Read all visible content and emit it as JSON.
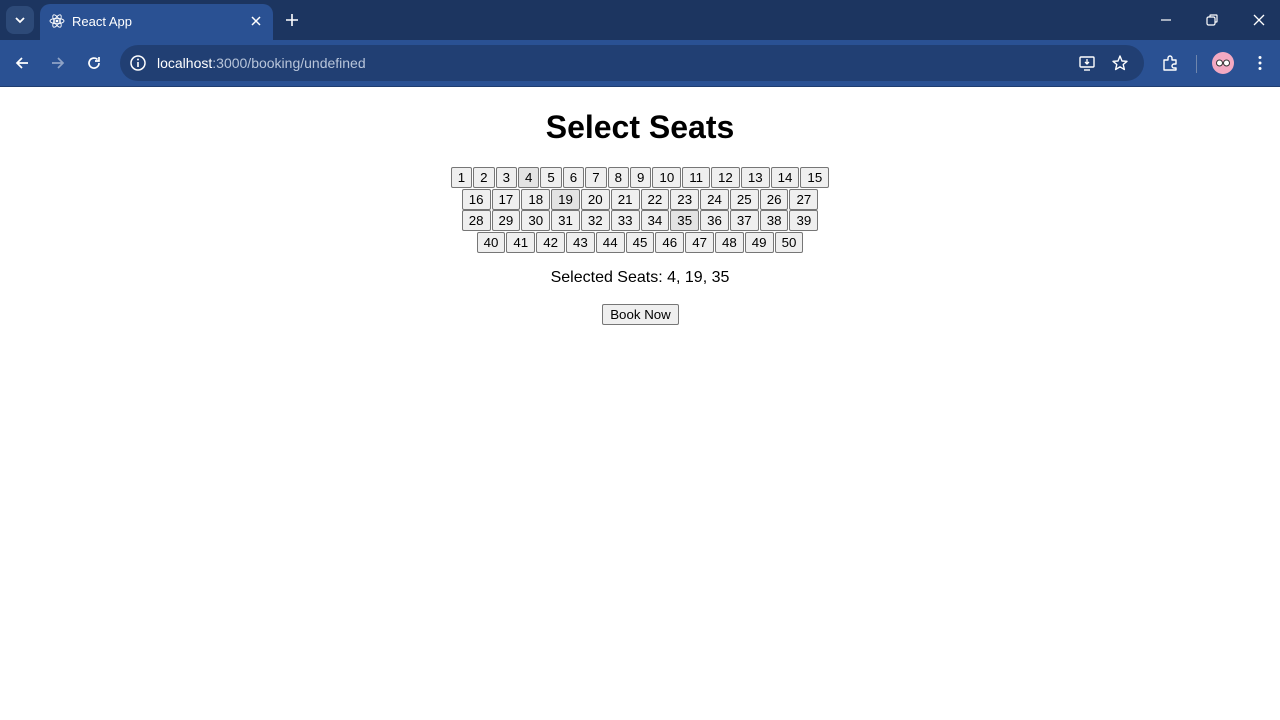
{
  "browser": {
    "tab_title": "React App",
    "url_host": "localhost",
    "url_rest": ":3000/booking/undefined"
  },
  "page": {
    "title": "Select Seats",
    "seat_rows": [
      [
        "1",
        "2",
        "3",
        "4",
        "5",
        "6",
        "7",
        "8",
        "9",
        "10",
        "11",
        "12",
        "13",
        "14",
        "15"
      ],
      [
        "16",
        "17",
        "18",
        "19",
        "20",
        "21",
        "22",
        "23",
        "24",
        "25",
        "26",
        "27"
      ],
      [
        "28",
        "29",
        "30",
        "31",
        "32",
        "33",
        "34",
        "35",
        "36",
        "37",
        "38",
        "39"
      ],
      [
        "40",
        "41",
        "42",
        "43",
        "44",
        "45",
        "46",
        "47",
        "48",
        "49",
        "50"
      ]
    ],
    "selected_seats_text": "Selected Seats: 4, 19, 35",
    "selected_seats": [
      "4",
      "19",
      "35"
    ],
    "book_button": "Book Now"
  },
  "colors": {
    "tabstrip": "#1c3560",
    "toolbar": "#2a5193",
    "button_face": "#efefef"
  },
  "icons": [
    "tab-search-icon",
    "react-icon",
    "close-icon",
    "plus-icon",
    "minimize-icon",
    "restore-icon",
    "window-close-icon",
    "back-icon",
    "forward-icon",
    "reload-icon",
    "info-icon",
    "install-icon",
    "star-icon",
    "extensions-icon",
    "avatar",
    "menu-icon"
  ]
}
